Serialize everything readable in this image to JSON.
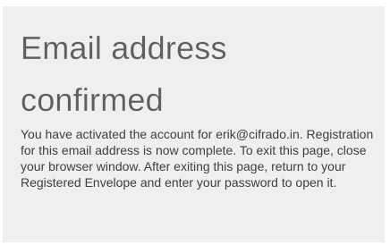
{
  "page": {
    "title": "Email address confirmed",
    "message": "You have activated the account for erik@cifrado.in. Registration for this email address is now complete. To exit this page, close your browser window. After exiting this page, return to your Registered Envelope and enter your password to open it."
  },
  "colors": {
    "page_background": "#ffffff",
    "panel_background": "#efefef",
    "title_text": "#5e5e5e",
    "body_text": "#3e3e3e"
  }
}
